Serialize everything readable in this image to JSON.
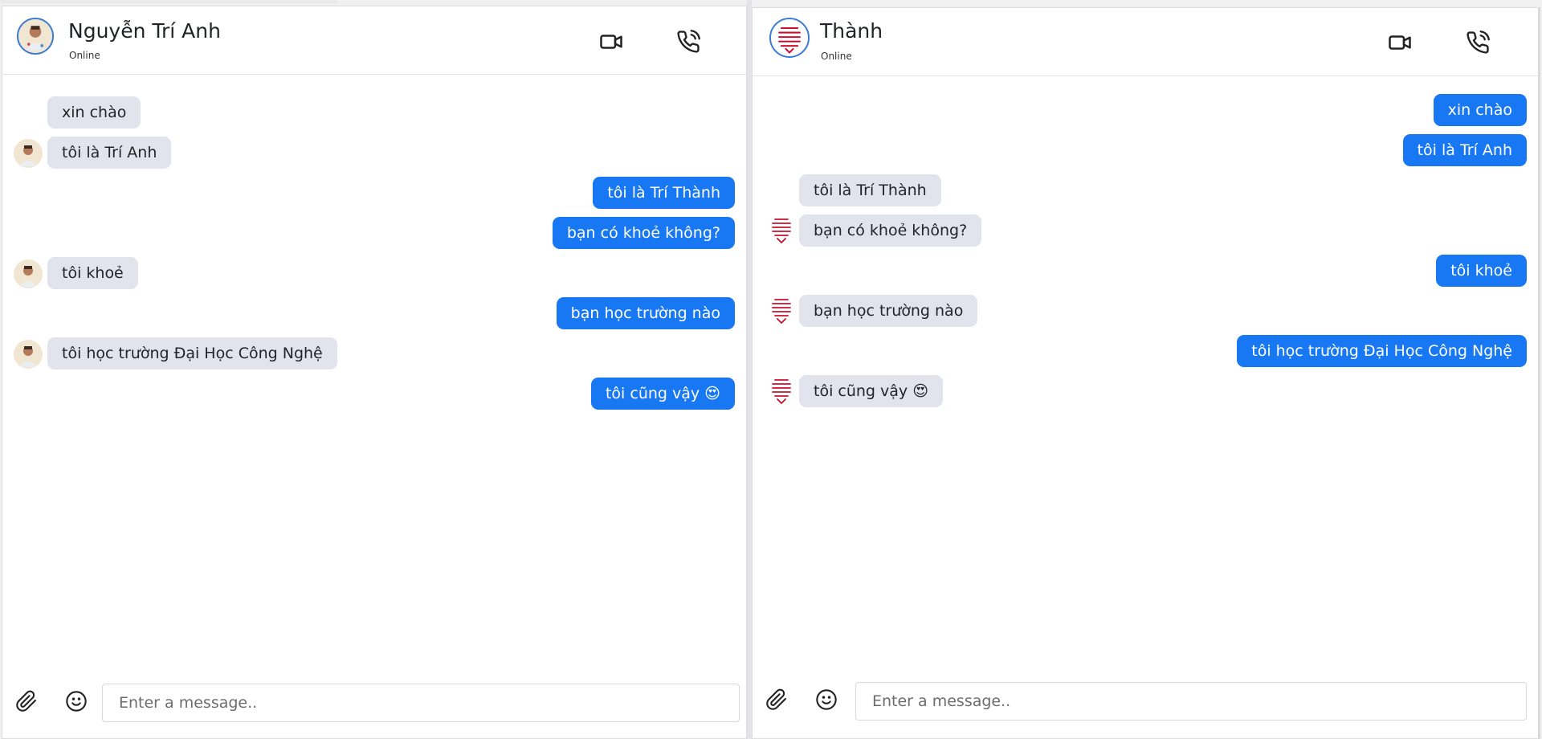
{
  "left_chat": {
    "contact": {
      "name": "Nguyễn Trí Anh",
      "status": "Online"
    },
    "messages": [
      {
        "text": "xin chào",
        "side": "in",
        "show_avatar": false
      },
      {
        "text": "tôi là Trí Anh",
        "side": "in",
        "show_avatar": true
      },
      {
        "text": "tôi là Trí Thành",
        "side": "out"
      },
      {
        "text": "bạn có khoẻ không?",
        "side": "out"
      },
      {
        "text": "tôi khoẻ",
        "side": "in",
        "show_avatar": true
      },
      {
        "text": "bạn học trường nào",
        "side": "out"
      },
      {
        "text": "tôi học trường Đại Học Công Nghệ",
        "side": "in",
        "show_avatar": true
      },
      {
        "text": "tôi cũng vậy 😍",
        "side": "out"
      }
    ],
    "composer": {
      "placeholder": "Enter a message.."
    }
  },
  "right_chat": {
    "contact": {
      "name": "Thành",
      "status": "Online"
    },
    "messages": [
      {
        "text": "xin chào",
        "side": "out"
      },
      {
        "text": "tôi là Trí Anh",
        "side": "out"
      },
      {
        "text": "tôi là Trí Thành",
        "side": "in",
        "show_avatar": false
      },
      {
        "text": "bạn có khoẻ không?",
        "side": "in",
        "show_avatar": true
      },
      {
        "text": "tôi khoẻ",
        "side": "out"
      },
      {
        "text": "bạn học trường nào",
        "side": "in",
        "show_avatar": true
      },
      {
        "text": "tôi học trường Đại Học Công Nghệ",
        "side": "out"
      },
      {
        "text": "tôi cũng vậy 😍",
        "side": "in",
        "show_avatar": true
      }
    ],
    "composer": {
      "placeholder": "Enter a message.."
    }
  },
  "icons": {
    "video_call": "video-camera-icon",
    "voice_call": "phone-icon",
    "attach": "paperclip-icon",
    "emoji": "smiley-icon"
  },
  "colors": {
    "outgoing_bubble": "#1877f2",
    "incoming_bubble": "#e1e4ec",
    "avatar_ring": "#3a7bd5",
    "logo_red": "#c8102e"
  }
}
